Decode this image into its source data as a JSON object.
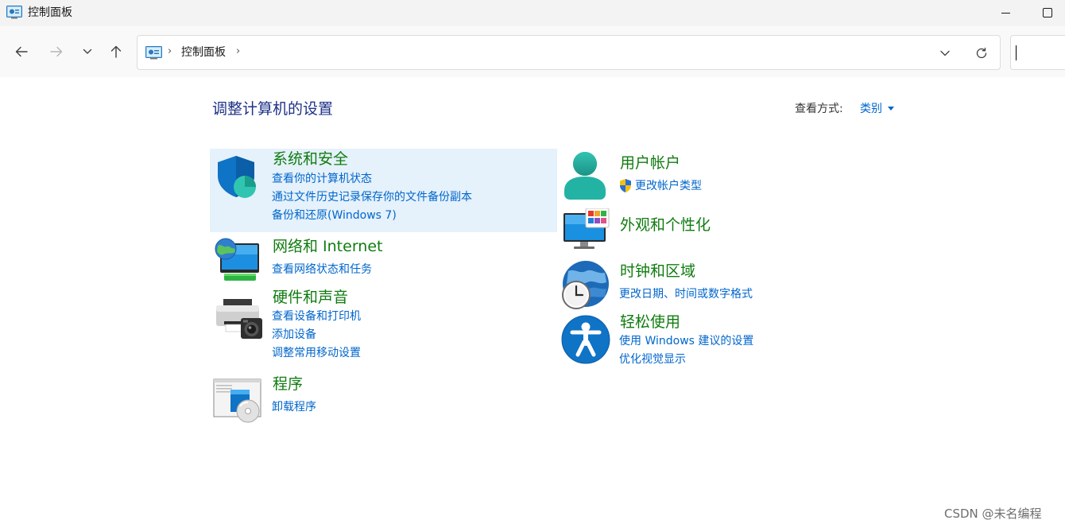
{
  "window": {
    "title": "控制面板",
    "minimize_label": "minimize",
    "maximize_label": "maximize"
  },
  "navbar": {
    "path": "控制面板",
    "separator": "›",
    "search_value": ""
  },
  "header": {
    "title": "调整计算机的设置",
    "viewby_label": "查看方式:",
    "viewby_value": "类别"
  },
  "categories_left": [
    {
      "title": "系统和安全",
      "icon": "shield-icon",
      "links": [
        "查看你的计算机状态",
        "通过文件历史记录保存你的文件备份副本",
        "备份和还原(Windows 7)"
      ]
    },
    {
      "title": "网络和 Internet",
      "icon": "network-icon",
      "links": [
        "查看网络状态和任务"
      ]
    },
    {
      "title": "硬件和声音",
      "icon": "printer-icon",
      "links": [
        "查看设备和打印机",
        "添加设备",
        "调整常用移动设置"
      ]
    },
    {
      "title": "程序",
      "icon": "programs-icon",
      "links": [
        "卸载程序"
      ]
    }
  ],
  "categories_right": [
    {
      "title": "用户帐户",
      "icon": "user-icon",
      "links": [
        "更改帐户类型"
      ]
    },
    {
      "title": "外观和个性化",
      "icon": "monitor-personalize-icon",
      "links": []
    },
    {
      "title": "时钟和区域",
      "icon": "clock-globe-icon",
      "links": [
        "更改日期、时间或数字格式"
      ]
    },
    {
      "title": "轻松使用",
      "icon": "accessibility-icon",
      "links": [
        "使用 Windows 建议的设置",
        "优化视觉显示"
      ]
    }
  ],
  "watermark": "CSDN @未名编程",
  "colors": {
    "title_blue": "#1e3287",
    "category_green": "#107c10",
    "link_blue": "#0066cc",
    "highlight": "#e5f1fb"
  }
}
